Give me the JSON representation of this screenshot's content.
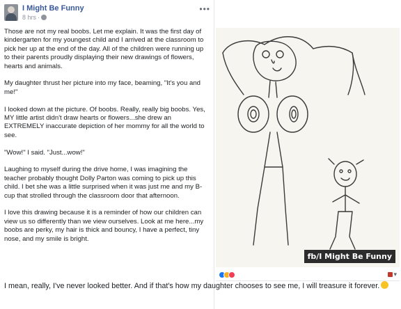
{
  "post": {
    "page_name": "I Might Be Funny",
    "timestamp": "8 hrs",
    "meta_separator": "·",
    "more_label": "•••",
    "paragraphs": [
      "Those are not my real boobs. Let me explain. It was the first day of kindergarten for my youngest child and I arrived at the classroom to pick her up at the end of the day. All of the children were running up to their parents proudly displaying their new drawings of flowers, hearts and animals.",
      "My daughter thrust her picture into my face, beaming, \"It's you and me!\"",
      "I looked down at the picture. Of boobs. Really, really big boobs. Yes, MY little artist didn't draw hearts or flowers...she drew an EXTREMELY inaccurate depiction of her mommy for all the world to see.",
      "\"Wow!\" I said. \"Just...wow!\"",
      "Laughing to myself during the drive home, I was imagining the teacher probably thought Dolly Parton was coming to pick up this child. I bet she was a little surprised when it was just me and my B-cup that strolled through the classroom door that afternoon.",
      "I love this drawing because it is a reminder of how our children can view us so differently than we view ourselves. Look at me here...my boobs are perky, my hair is thick and bouncy, I have a perfect, tiny nose, and my smile is bright."
    ],
    "closing": "I mean, really, I've never looked better. And if that's how my daughter chooses to see me, I will treasure it forever."
  },
  "photo": {
    "watermark": "fb/I Might Be Funny"
  },
  "icons": {
    "avatar": "avatar",
    "globe": "globe-icon",
    "more": "more-icon",
    "reactions": [
      "like-icon",
      "haha-icon",
      "love-icon"
    ],
    "share": "share-icon",
    "emoji": "smile-emoji-icon"
  },
  "colors": {
    "brand_link": "#385898",
    "text": "#1c1e21",
    "meta": "#90949c",
    "like": "#1877f2",
    "love": "#f33e58",
    "haha": "#f7b125"
  }
}
